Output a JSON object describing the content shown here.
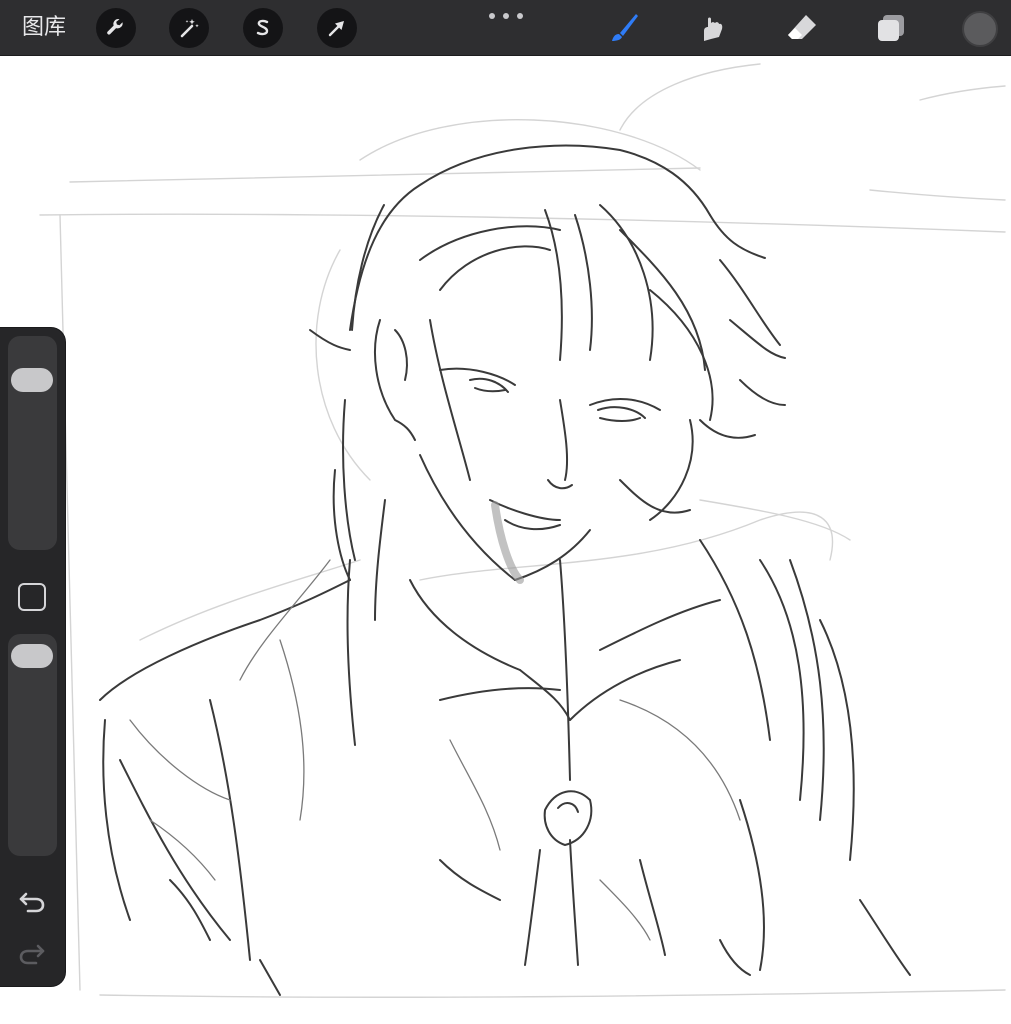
{
  "topbar": {
    "gallery_label": "图库",
    "left_tools": [
      {
        "name": "actions-wrench-icon"
      },
      {
        "name": "adjustments-magic-wand-icon"
      },
      {
        "name": "selection-s-icon"
      },
      {
        "name": "transform-arrow-icon"
      }
    ],
    "more_icon": "more-dots-icon",
    "right_tools": [
      {
        "name": "brush-icon",
        "active": true,
        "color": "#2f7cf6"
      },
      {
        "name": "smudge-icon",
        "active": false
      },
      {
        "name": "eraser-icon",
        "active": false
      },
      {
        "name": "layers-icon",
        "active": false
      }
    ],
    "current_color": "#5b5b5d"
  },
  "sidebar": {
    "brush_size_slider": "brush-size-slider",
    "opacity_slider": "opacity-slider",
    "modifier_button": "modifier-square-icon",
    "undo_icon": "undo-icon",
    "redo_icon": "redo-icon"
  },
  "canvas": {
    "content": "pencil-sketch"
  },
  "colors": {
    "toolbar_bg": "#2e2e30",
    "button_bg": "#141416",
    "accent": "#2f7cf6",
    "sidebar_bg": "#262628",
    "canvas_bg": "#ffffff"
  }
}
